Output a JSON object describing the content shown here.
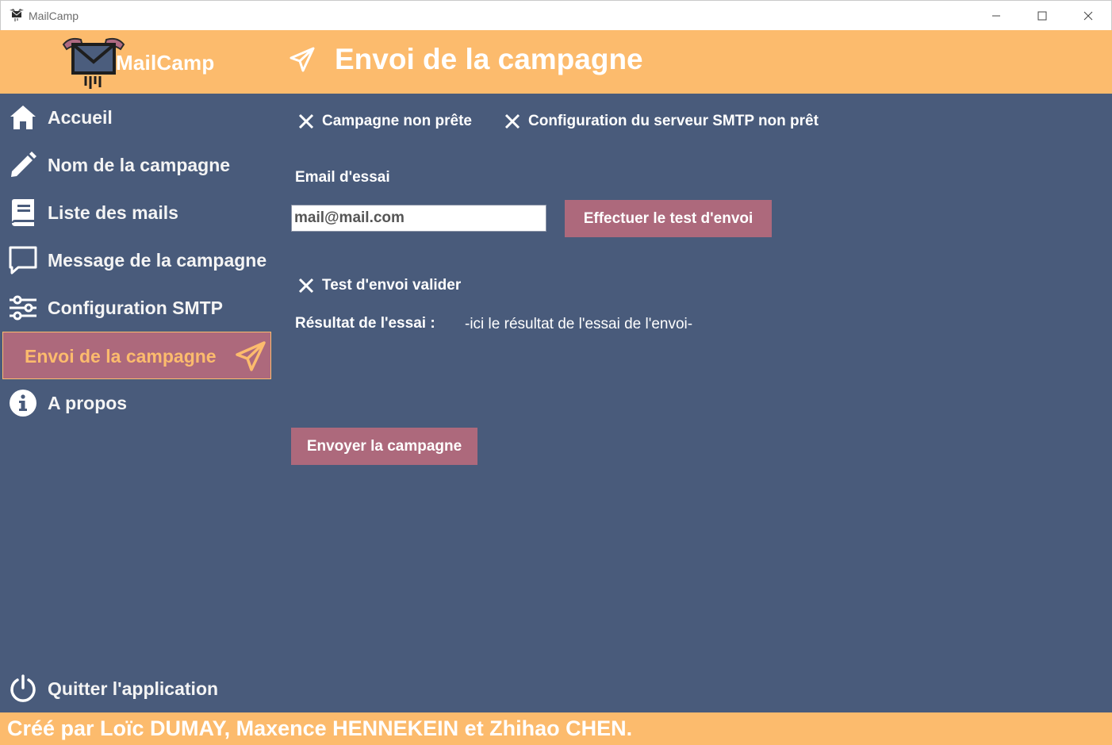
{
  "window": {
    "title": "MailCamp"
  },
  "header": {
    "brand": "MailCamp",
    "page_title": "Envoi de la campagne"
  },
  "sidebar": {
    "items": [
      {
        "label": "Accueil",
        "icon": "home-icon"
      },
      {
        "label": "Nom de la campagne",
        "icon": "pencil-icon"
      },
      {
        "label": "Liste des mails",
        "icon": "book-icon"
      },
      {
        "label": "Message de la campagne",
        "icon": "chat-bubble-icon"
      },
      {
        "label": "Configuration SMTP",
        "icon": "sliders-icon"
      },
      {
        "label": "Envoi de la campagne",
        "icon": "paper-plane-icon",
        "active": true
      },
      {
        "label": "A propos",
        "icon": "info-icon"
      }
    ],
    "quit": {
      "label": "Quitter l'application",
      "icon": "power-icon"
    }
  },
  "main": {
    "status": [
      {
        "text": "Campagne non prête",
        "icon": "x-icon"
      },
      {
        "text": "Configuration du serveur SMTP non prêt",
        "icon": "x-icon"
      }
    ],
    "email_label": "Email d'essai",
    "email_value": "mail@mail.com",
    "test_button": "Effectuer le test d'envoi",
    "test_status": "Test d'envoi valider",
    "result_label": "Résultat de l'essai :",
    "result_value": "-ici le résultat de l'essai de l'envoi-",
    "send_button": "Envoyer la campagne"
  },
  "footer": {
    "credit": "Créé par Loïc DUMAY, Maxence HENNEKEIN et Zhihao CHEN."
  },
  "colors": {
    "accent": "#fcbb6d",
    "panel": "#495b7b",
    "button": "#ad697c",
    "text": "#ffffff"
  }
}
